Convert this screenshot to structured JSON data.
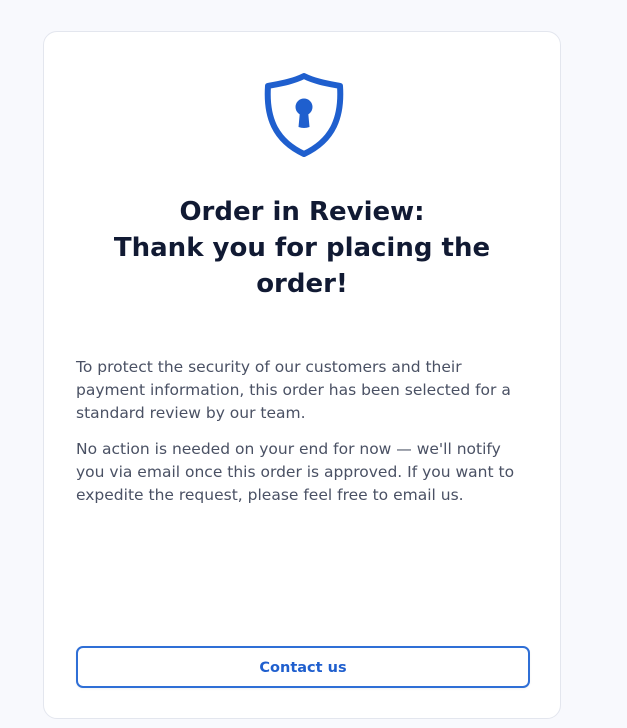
{
  "colors": {
    "accent": "#1f5fce",
    "title": "#111a33",
    "body_text": "#4a5164",
    "background": "#f8f9fd",
    "card": "#ffffff"
  },
  "card": {
    "icon": "shield-keyhole-icon",
    "title_lines": [
      "Order in Review:",
      "Thank you for placing the",
      "order!"
    ],
    "paragraphs": [
      "To protect the security of our customers and their payment information, this order has been selected for a standard review by our team.",
      "No action is needed on your end for now — we'll notify you via email once this order is approved. If you want to expedite the request, please feel free to email us."
    ],
    "contact_button_label": "Contact us"
  }
}
